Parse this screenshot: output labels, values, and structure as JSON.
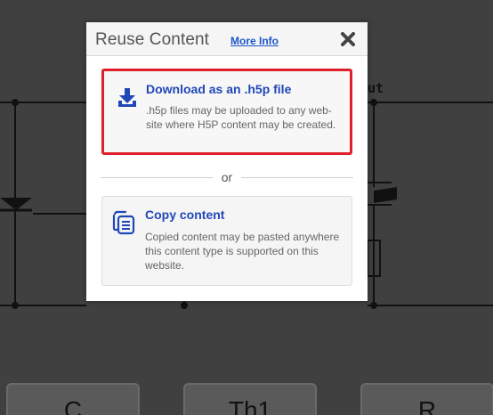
{
  "dialog": {
    "title": "Reuse Content",
    "more_info_label": "More Info",
    "close_icon": "close-icon"
  },
  "options": {
    "download": {
      "title": "Download as an .h5p file",
      "description": ".h5p files may be uploaded to any web-site where H5P content may be created.",
      "icon": "download-icon"
    },
    "copy": {
      "title": "Copy content",
      "description": "Copied content may be pasted anywhere this content type is supported on this website.",
      "icon": "copy-icon"
    }
  },
  "separator": {
    "label": "or"
  },
  "background": {
    "circuit_label": "ut",
    "buttons": [
      "C",
      "Th1",
      "R"
    ]
  },
  "colors": {
    "accent": "#2047b8",
    "highlight_border": "#e0202a",
    "overlay": "#404040"
  }
}
